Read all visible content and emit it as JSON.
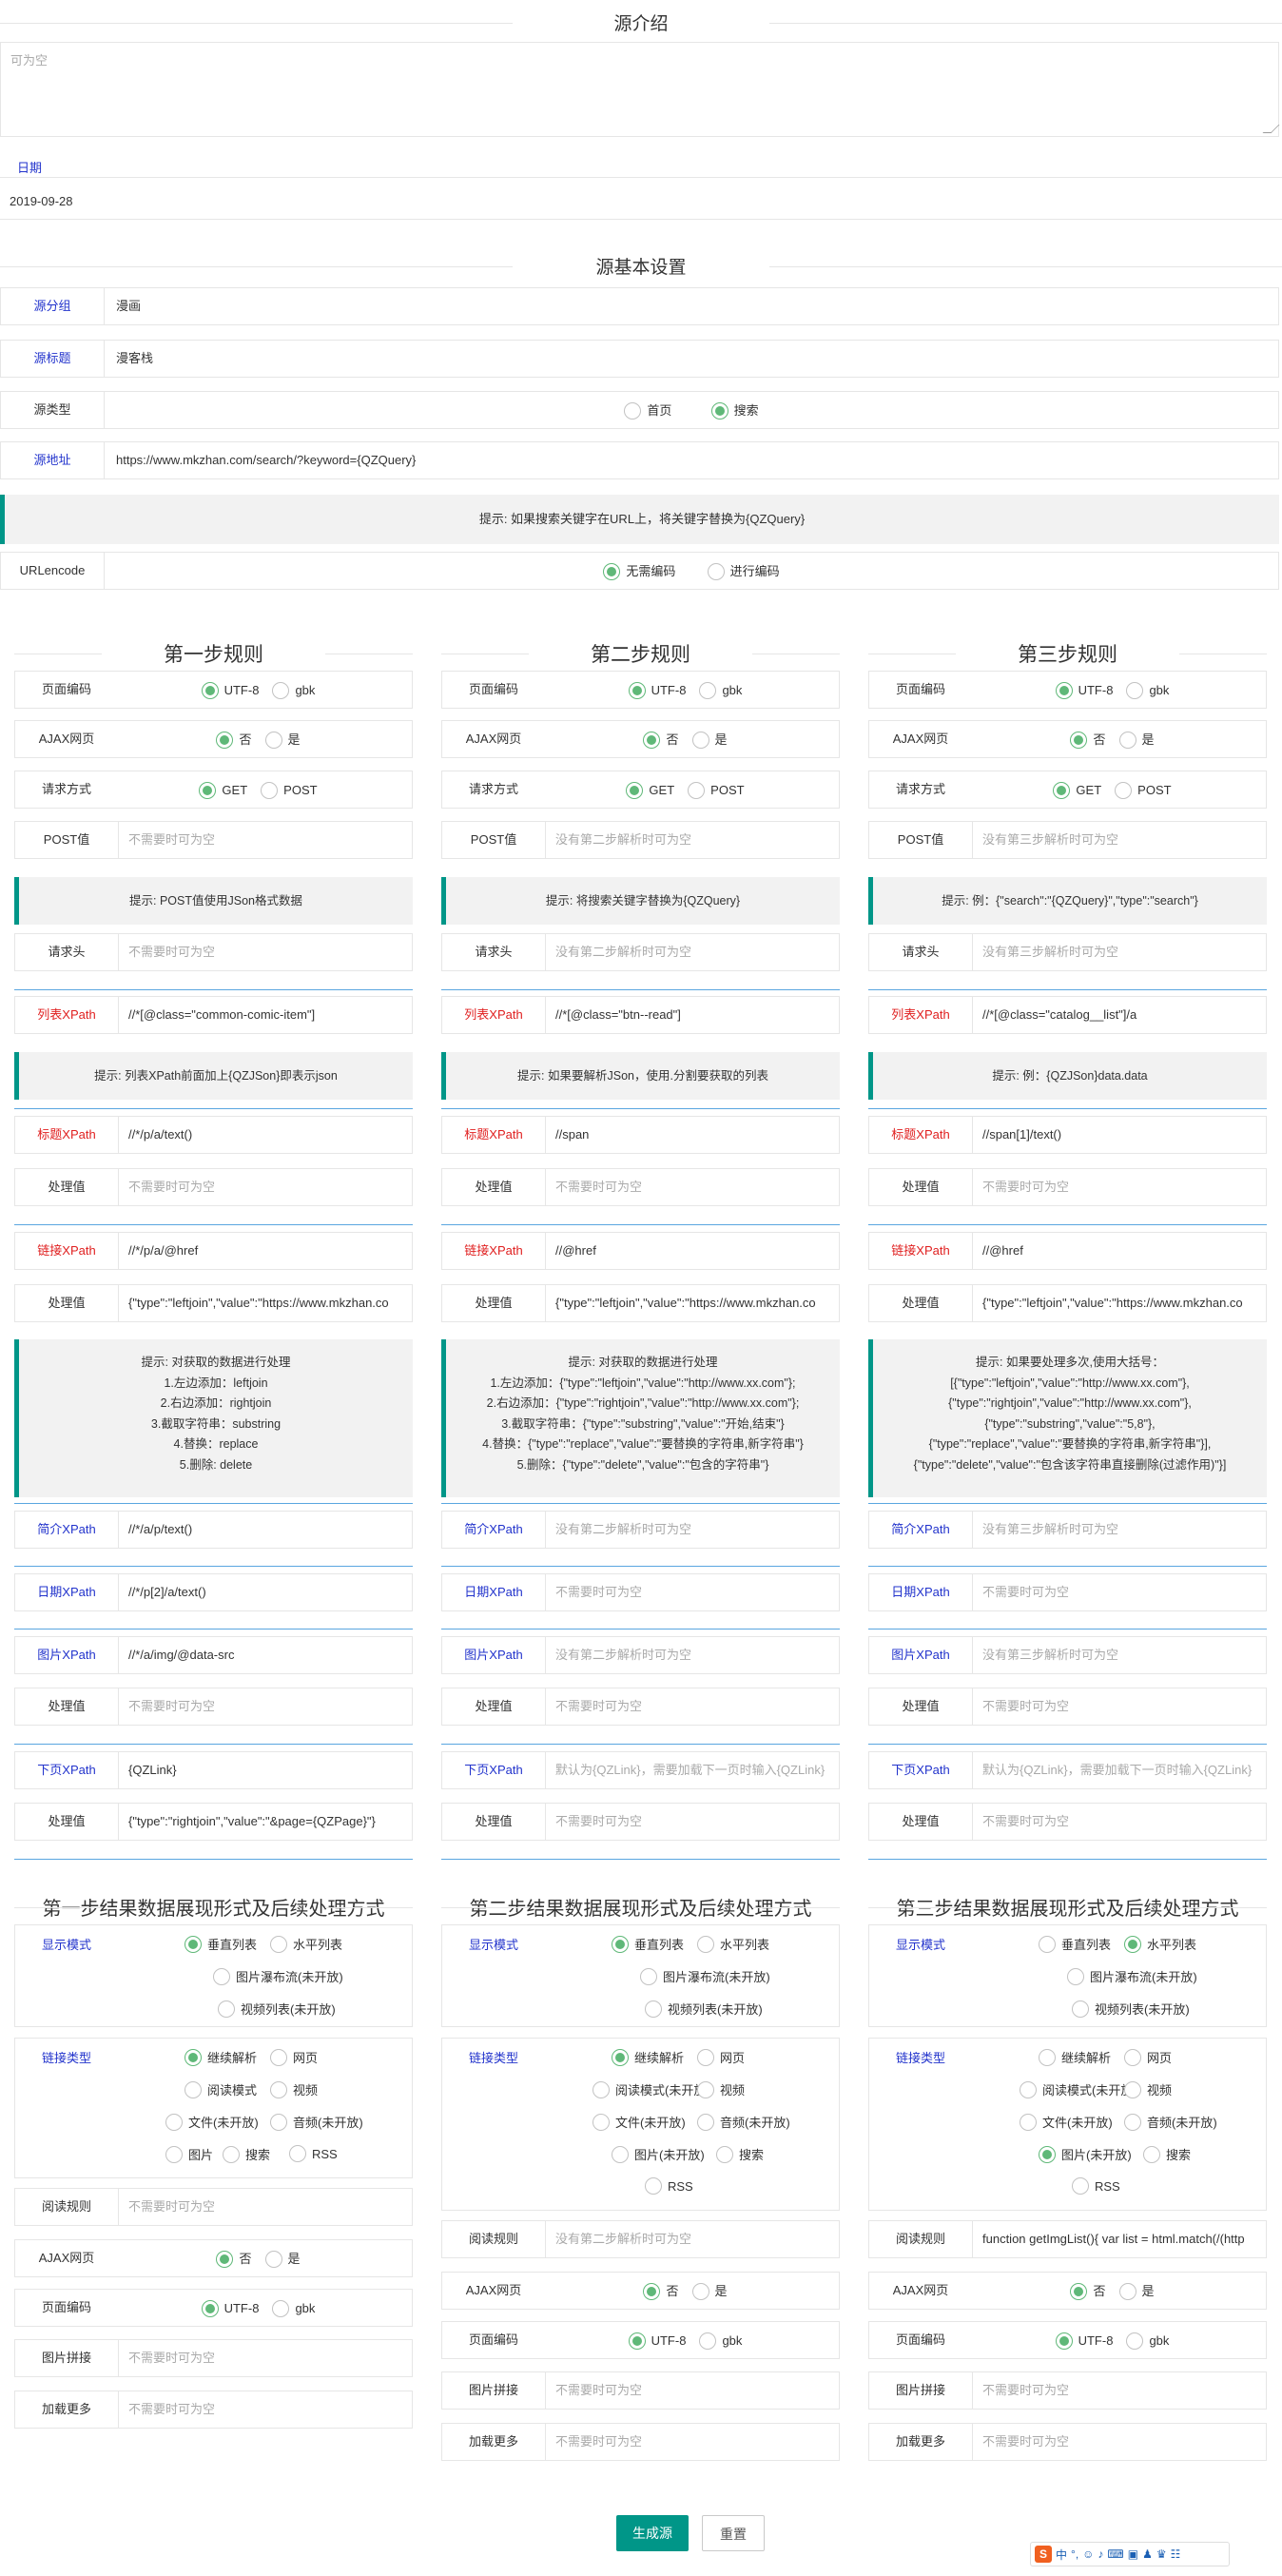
{
  "intro": {
    "title": "源介绍",
    "placeholder": "可为空",
    "date_label": "日期",
    "date_value": "2019-09-28"
  },
  "basic": {
    "title": "源基本设置",
    "group_label": "源分组",
    "group_value": "漫画",
    "name_label": "源标题",
    "name_value": "漫客栈",
    "type_label": "源类型",
    "type_opts": [
      "首页",
      "搜索"
    ],
    "url_label": "源地址",
    "url_value": "https://www.mkzhan.com/search/?keyword={QZQuery}",
    "tip": "提示: 如果搜索关键字在URL上，将关键字替换为{QZQuery}",
    "enc_label": "URLencode",
    "enc_opts": [
      "无需编码",
      "进行编码"
    ]
  },
  "common": {
    "page_enc": "页面编码",
    "utf8": "UTF-8",
    "gbk": "gbk",
    "ajax": "AJAX网页",
    "no": "否",
    "yes": "是",
    "method": "请求方式",
    "get": "GET",
    "post": "POST",
    "post_val": "POST值",
    "header": "请求头",
    "list_xpath": "列表XPath",
    "title_xpath": "标题XPath",
    "proc": "处理值",
    "link_xpath": "链接XPath",
    "desc_xpath": "简介XPath",
    "date_xpath": "日期XPath",
    "img_xpath": "图片XPath",
    "next_xpath": "下页XPath",
    "ph_empty": "不需要时可为空"
  },
  "step1": {
    "title": "第一步规则",
    "post_ph": "不需要时可为空",
    "tip_post": "提示: POST值使用JSon格式数据",
    "header_ph": "不需要时可为空",
    "list_val": "//*[@class=\"common-comic-item\"]",
    "tip_list": "提示: 列表XPath前面加上{QZJSon}即表示json",
    "title_val": "//*/p/a/text()",
    "proc1_ph": "不需要时可为空",
    "link_val": "//*/p/a/@href",
    "proc2_val": "{\"type\":\"leftjoin\",\"value\":\"https://www.mkzhan.co",
    "tip_proc": [
      "提示: 对获取的数据进行处理",
      "1.左边添加：leftjoin",
      "2.右边添加：rightjoin",
      "3.截取字符串：substring",
      "4.替换：replace",
      "5.删除: delete"
    ],
    "desc_val": "//*/a/p/text()",
    "date_val": "//*/p[2]/a/text()",
    "img_val": "//*/a/img/@data-src",
    "proc3_ph": "不需要时可为空",
    "next_val": "{QZLink}",
    "proc4_val": "{\"type\":\"rightjoin\",\"value\":\"&page={QZPage}\"}"
  },
  "step2": {
    "title": "第二步规则",
    "post_ph": "没有第二步解析时可为空",
    "tip_post": "提示: 将搜索关键字替换为{QZQuery}",
    "header_ph": "没有第二步解析时可为空",
    "list_val": "//*[@class=\"btn--read\"]",
    "tip_list": "提示: 如果要解析JSon，使用.分割要获取的列表",
    "title_val": "//span",
    "proc1_ph": "不需要时可为空",
    "link_val": "//@href",
    "proc2_val": "{\"type\":\"leftjoin\",\"value\":\"https://www.mkzhan.co",
    "tip_proc": [
      "提示: 对获取的数据进行处理",
      "1.左边添加：{\"type\":\"leftjoin\",\"value\":\"http://www.xx.com\"};",
      "2.右边添加：{\"type\":\"rightjoin\",\"value\":\"http://www.xx.com\"};",
      "3.截取字符串：{\"type\":\"substring\",\"value\":\"开始,结束\"}",
      "4.替换：{\"type\":\"replace\",\"value\":\"要替换的字符串,新字符串\"}",
      "5.删除：{\"type\":\"delete\",\"value\":\"包含的字符串\"}"
    ],
    "desc_ph": "没有第二步解析时可为空",
    "date_ph": "不需要时可为空",
    "img_ph": "没有第二步解析时可为空",
    "proc3_ph": "不需要时可为空",
    "next_ph": "默认为{QZLink}，需要加载下一页时输入{QZLink}",
    "proc4_ph": "不需要时可为空"
  },
  "step3": {
    "title": "第三步规则",
    "post_ph": "没有第三步解析时可为空",
    "tip_post": "提示: 例：{\"search\":\"{QZQuery}\",\"type\":\"search\"}",
    "header_ph": "没有第三步解析时可为空",
    "list_val": "//*[@class=\"catalog__list\"]/a",
    "tip_list": "提示: 例：{QZJSon}data.data",
    "title_val": "//span[1]/text()",
    "proc1_ph": "不需要时可为空",
    "link_val": "//@href",
    "proc2_val": "{\"type\":\"leftjoin\",\"value\":\"https://www.mkzhan.co",
    "tip_proc": [
      "提示: 如果要处理多次,使用大括号：",
      "[{\"type\":\"leftjoin\",\"value\":\"http://www.xx.com\"},",
      "{\"type\":\"rightjoin\",\"value\":\"http://www.xx.com\"},",
      "{\"type\":\"substring\",\"value\":\"5,8\"},",
      "{\"type\":\"replace\",\"value\":\"要替换的字符串,新字符串\"}],",
      "{\"type\":\"delete\",\"value\":\"包含该字符串直接删除(过滤作用)\"}]"
    ],
    "desc_ph": "没有第三步解析时可为空",
    "date_ph": "不需要时可为空",
    "img_ph": "没有第三步解析时可为空",
    "proc3_ph": "不需要时可为空",
    "next_ph": "默认为{QZLink}，需要加载下一页时输入{QZLink}",
    "proc4_ph": "不需要时可为空"
  },
  "disp": {
    "t1": "第一步结果数据展现形式及后续处理方式",
    "t2": "第二步结果数据展现形式及后续处理方式",
    "t3": "第三步结果数据展现形式及后续处理方式",
    "mode_label": "显示模式",
    "vertical": "垂直列表",
    "horizontal": "水平列表",
    "waterfall": "图片瀑布流(未开放)",
    "video_list": "视频列表(未开放)",
    "link_label": "链接类型",
    "cont": "继续解析",
    "web": "网页",
    "read": "阅读模式",
    "read_na": "阅读模式(未开放)",
    "video": "视频",
    "file": "文件(未开放)",
    "audio": "音频(未开放)",
    "image": "图片",
    "image_na": "图片(未开放)",
    "search": "搜索",
    "rss": "RSS",
    "rule_label": "阅读规则",
    "rule_ph1": "不需要时可为空",
    "rule_ph2": "没有第二步解析时可为空",
    "rule_val3": "function getImgList(){ var list = html.match(/(http",
    "ajax": "AJAX网页",
    "enc": "页面编码",
    "join_label": "图片拼接",
    "more_label": "加载更多",
    "ph": "不需要时可为空"
  },
  "actions": {
    "submit": "生成源",
    "reset": "重置"
  },
  "ime": {
    "logo": "S",
    "items": [
      "中",
      "°,",
      "☺",
      "♪",
      "⌨",
      "▣",
      "♟",
      "♛",
      "☷"
    ]
  }
}
